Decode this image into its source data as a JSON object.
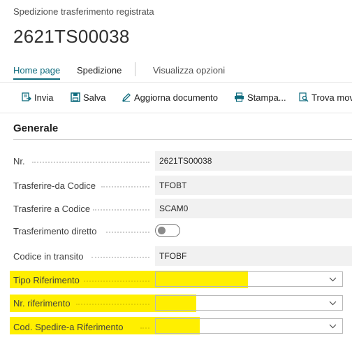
{
  "page": {
    "caption": "Spedizione trasferimento registrata",
    "document_no": "2621TS00038"
  },
  "tabs": [
    {
      "label": "Home page",
      "active": true
    },
    {
      "label": "Spedizione",
      "active": false
    },
    {
      "label": "Visualizza opzioni",
      "active": false
    }
  ],
  "actions": {
    "send": {
      "label": "Invia",
      "icon": "send-icon"
    },
    "save": {
      "label": "Salva",
      "icon": "save-icon"
    },
    "update": {
      "label": "Aggiorna documento",
      "icon": "pencil-icon"
    },
    "print": {
      "label": "Stampa...",
      "icon": "printer-icon"
    },
    "find": {
      "label": "Trova mov",
      "icon": "search-document-icon"
    }
  },
  "section": {
    "title": "Generale"
  },
  "fields": {
    "no": {
      "label": "Nr.",
      "value": "2621TS00038"
    },
    "transfer_from": {
      "label": "Trasferire-da Codice",
      "value": "TFOBT"
    },
    "transfer_to": {
      "label": "Trasferire a Codice",
      "value": "SCAM0"
    },
    "direct_transfer": {
      "label": "Trasferimento diretto",
      "value": false
    },
    "in_transit": {
      "label": "Codice in transito",
      "value": "TFOBF"
    },
    "ref_type": {
      "label": "Tipo Riferimento",
      "value": ""
    },
    "ref_no": {
      "label": "Nr. riferimento",
      "value": ""
    },
    "ship_to_ref": {
      "label": "Cod. Spedire-a Riferimento",
      "value": ""
    }
  },
  "colors": {
    "accent": "#0f6c7e",
    "highlight": "#ffef00",
    "field_bg": "#f1f1f1"
  }
}
